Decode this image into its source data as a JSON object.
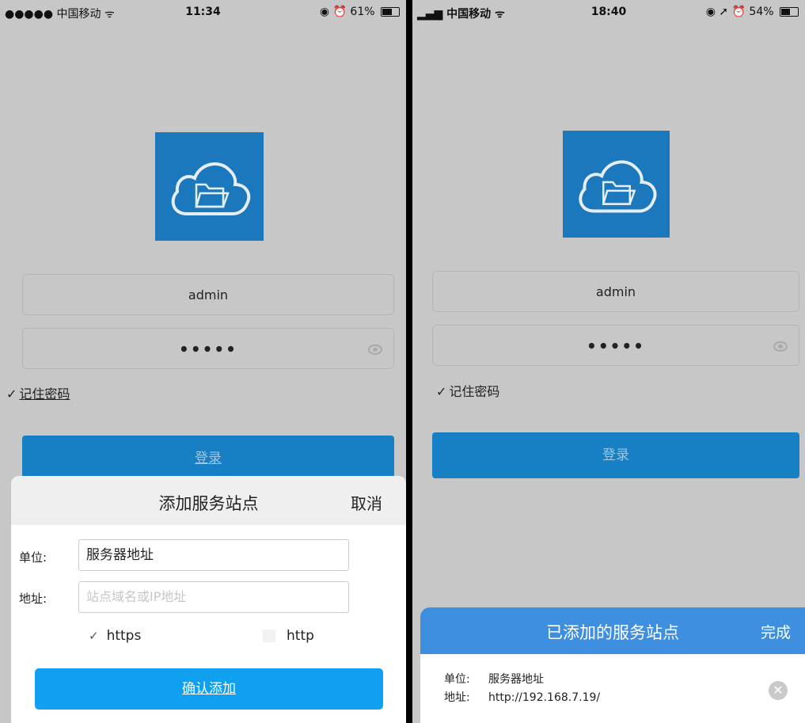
{
  "left": {
    "status": {
      "carrier": "●●●●● 中国移动 ᯤ",
      "time": "11:34",
      "indicators": "◉ ⏰ 61%",
      "battery_level": 0.61
    },
    "logo_icon": "cloud-folder-icon",
    "username": "admin",
    "password_mask": "•••••",
    "remember_label": "记住密码",
    "login_label": "登录",
    "sheet": {
      "title": "添加服务站点",
      "cancel": "取消",
      "unit_label": "单位:",
      "unit_value": "服务器地址",
      "address_label": "地址:",
      "address_placeholder": "站点域名或IP地址",
      "https_label": "https",
      "http_label": "http",
      "confirm_label": "确认添加"
    }
  },
  "right": {
    "status": {
      "carrier": "▂▄▆ 中国移动 ᯤ",
      "time": "18:40",
      "indicators": "◉ ➚ ⏰ 54%",
      "battery_level": 0.54
    },
    "logo_icon": "cloud-folder-icon",
    "username": "admin",
    "password_mask": "•••••",
    "remember_label": "记住密码",
    "login_label": "登录",
    "added": {
      "title": "已添加的服务站点",
      "done": "完成",
      "unit_label": "单位:",
      "unit_value": "服务器地址",
      "address_label": "地址:",
      "address_value": "http://192.168.7.19/",
      "remove_icon": "close-circle-icon"
    }
  }
}
